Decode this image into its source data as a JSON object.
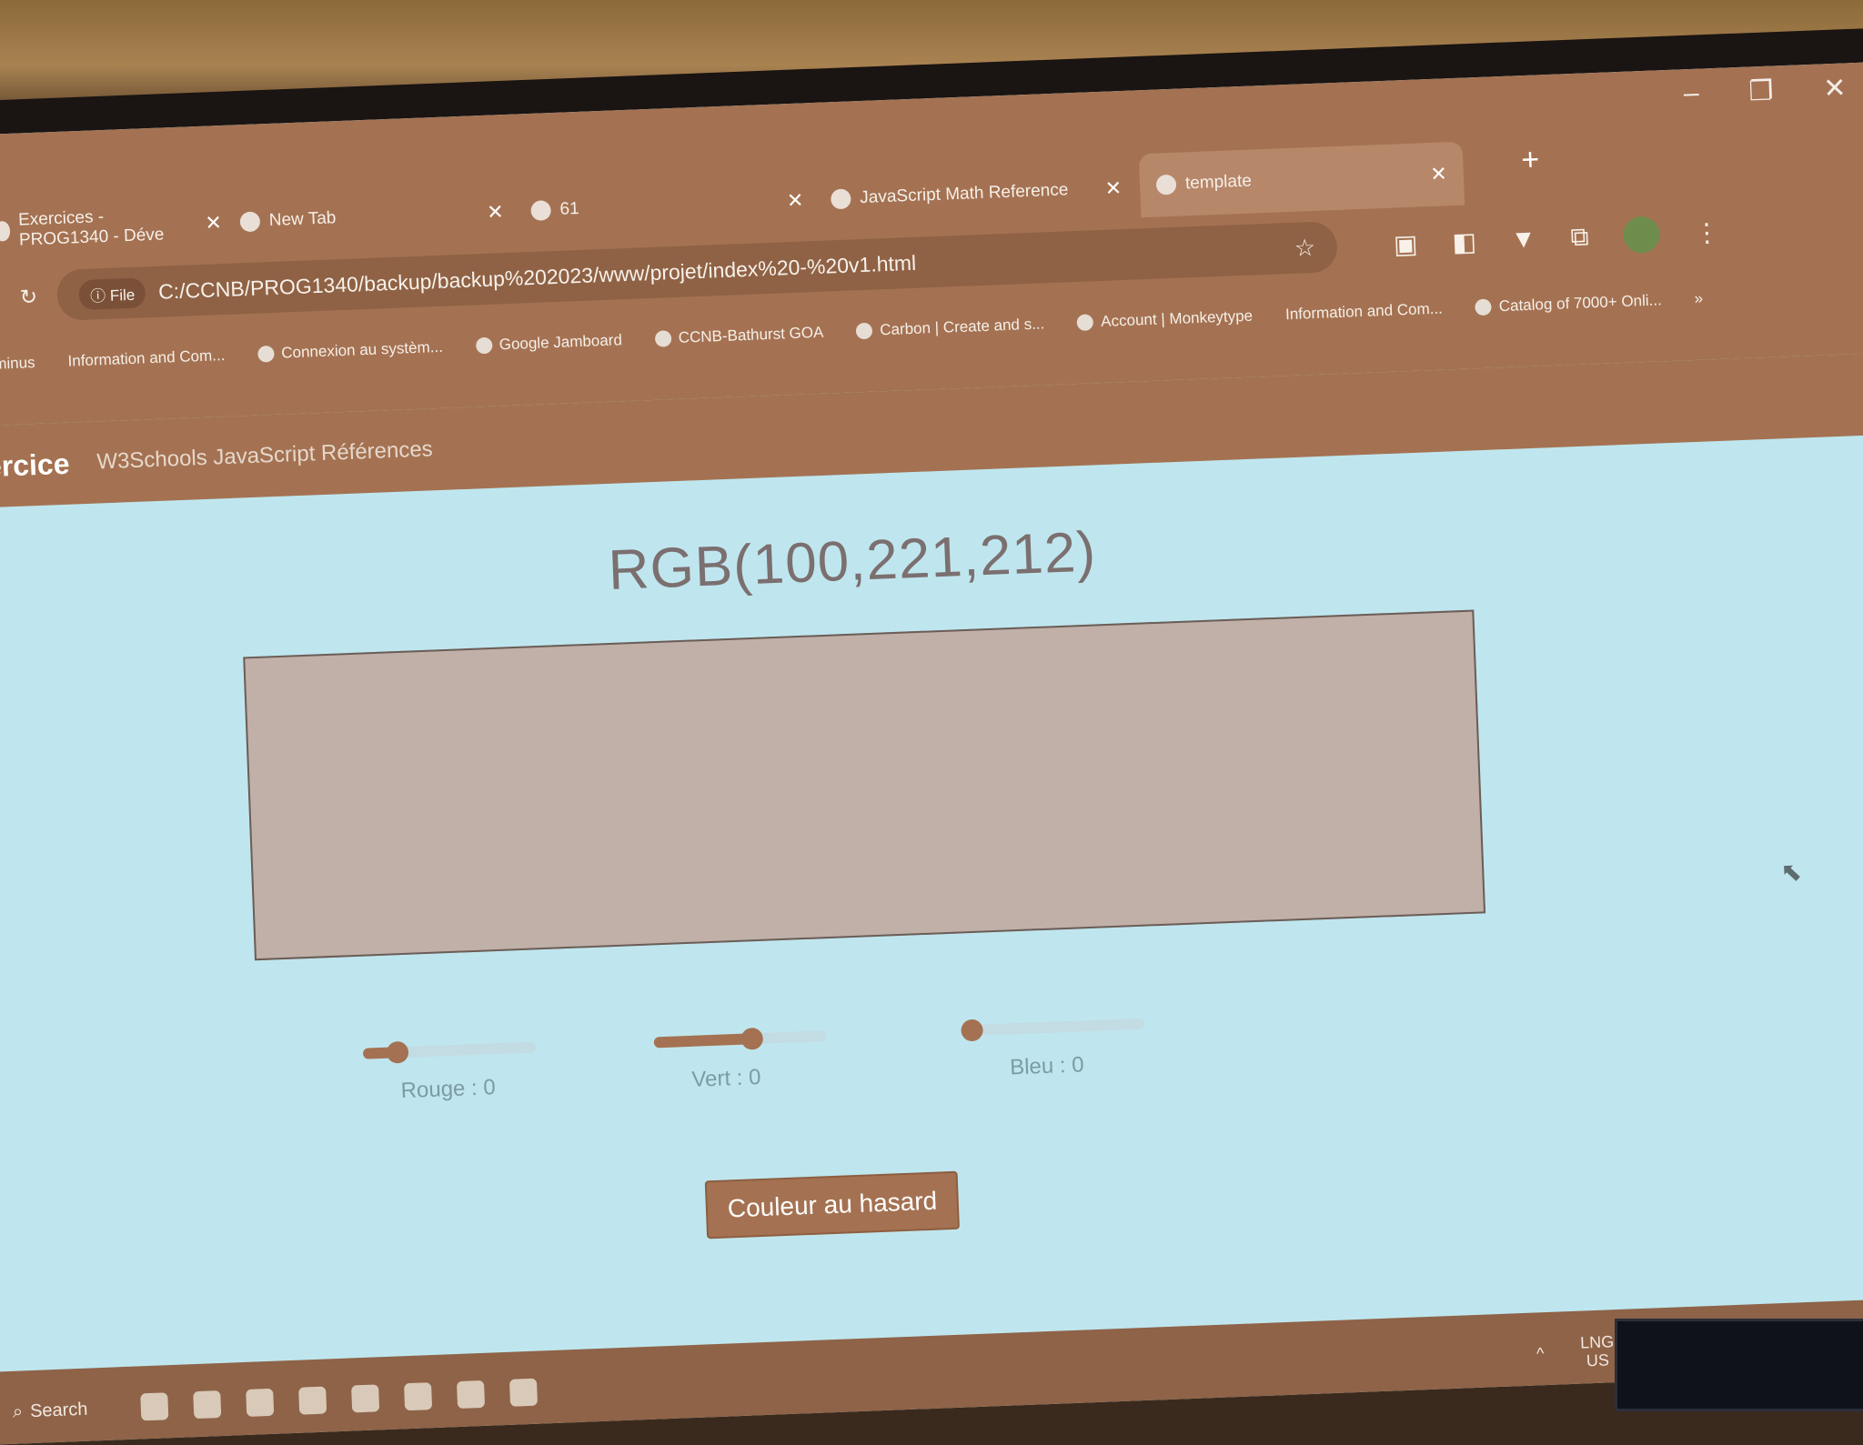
{
  "tabs": [
    {
      "title": "Exercices - PROG1340 - Déve",
      "icon": "d2l-icon"
    },
    {
      "title": "New Tab",
      "icon": "chrome-icon"
    },
    {
      "title": "61",
      "icon": "globe-icon"
    },
    {
      "title": "JavaScript Math Reference",
      "icon": "w3schools-icon"
    },
    {
      "title": "template",
      "icon": "globe-icon",
      "active": true
    }
  ],
  "toolbar": {
    "file_chip": "File",
    "url": "C:/CCNB/PROG1340/backup/backup%202023/www/projet/index%20-%20v1.html"
  },
  "bookmarks": [
    "Terminus",
    "Information and Com...",
    "Connexion au systèm...",
    "Google Jamboard",
    "CCNB-Bathurst GOA",
    "Carbon | Create and s...",
    "Account | Monkeytype",
    "Information and Com...",
    "Catalog of 7000+ Onli..."
  ],
  "navbar": {
    "brand": "ercice",
    "link": "W3Schools JavaScript Références"
  },
  "main": {
    "rgb_text": "RGB(100,221,212)",
    "swatch_color": "#c0b0a8",
    "sliders": [
      {
        "label": "Rouge : 0",
        "value": 0.2
      },
      {
        "label": "Vert : 0",
        "value": 0.57
      },
      {
        "label": "Bleu : 0",
        "value": 0.0
      }
    ],
    "random_button": "Couleur au hasard"
  },
  "taskbar": {
    "search": "Search",
    "lang": "LNG",
    "region": "US"
  },
  "colors": {
    "accent": "#a47252",
    "page_bg": "#bfe6ee"
  }
}
